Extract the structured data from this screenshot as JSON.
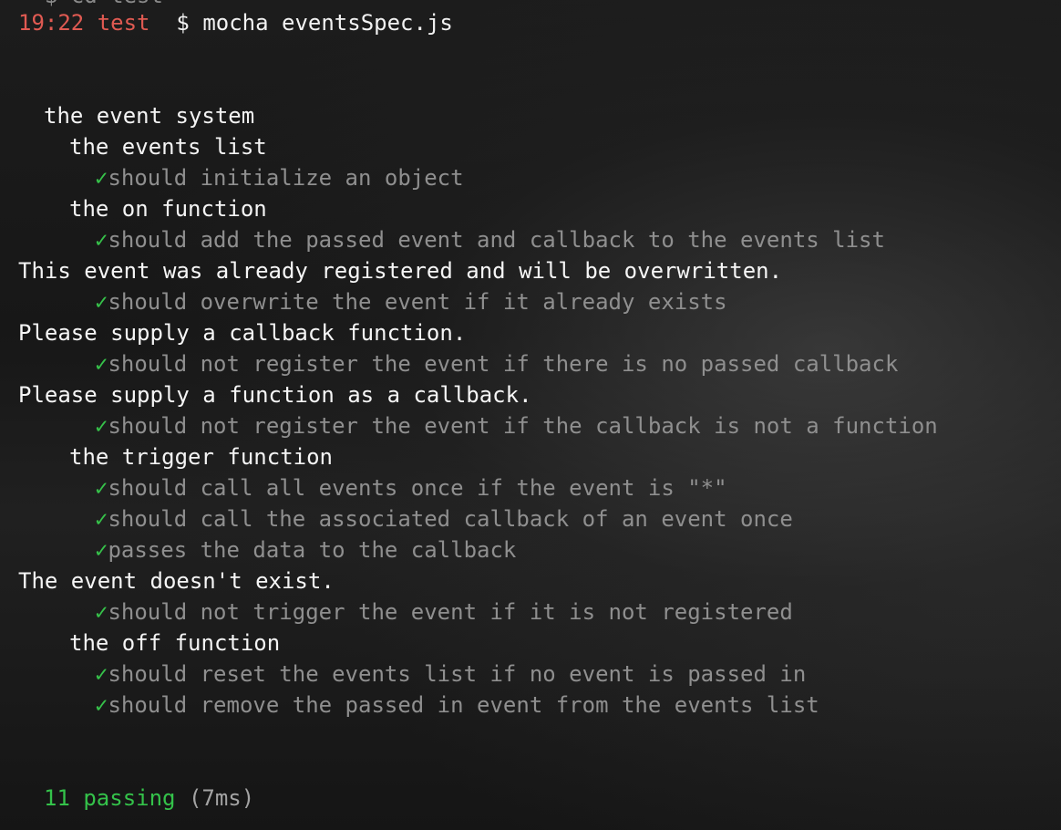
{
  "window": {
    "cutoff_text": "~ $ cd test"
  },
  "prompt": {
    "time": "19:22",
    "dir": "test",
    "symbol": "$",
    "command": "mocha eventsSpec.js"
  },
  "output": {
    "root_suite": "the event system",
    "check_glyph": "✓",
    "suites": {
      "events_list": "the events list",
      "on": "the on function",
      "trigger": "the trigger function",
      "off": "the off function"
    },
    "tests": [
      "should initialize an object",
      "should add the passed event and callback to the events list",
      "should overwrite the event if it already exists",
      "should not register the event if there is no passed callback",
      "should not register the event if the callback is not a function",
      "should call all events once if the event is \"*\"",
      "should call the associated callback of an event once",
      "passes the data to the callback",
      "should not trigger the event if it is not registered",
      "should reset the events list if no event is passed in",
      "should remove the passed in event from the events list"
    ],
    "logs": [
      "This event was already registered and will be overwritten.",
      "Please supply a callback function.",
      "Please supply a function as a callback.",
      "The event doesn't exist."
    ],
    "summary": {
      "passing": "11 passing",
      "duration": "(7ms)"
    }
  },
  "colors": {
    "background": "#161616",
    "prompt": "#e05a52",
    "check": "#36c24a",
    "passing": "#34c24a",
    "test_text": "#8f8f8f",
    "suite_text": "#f4f4f4"
  }
}
